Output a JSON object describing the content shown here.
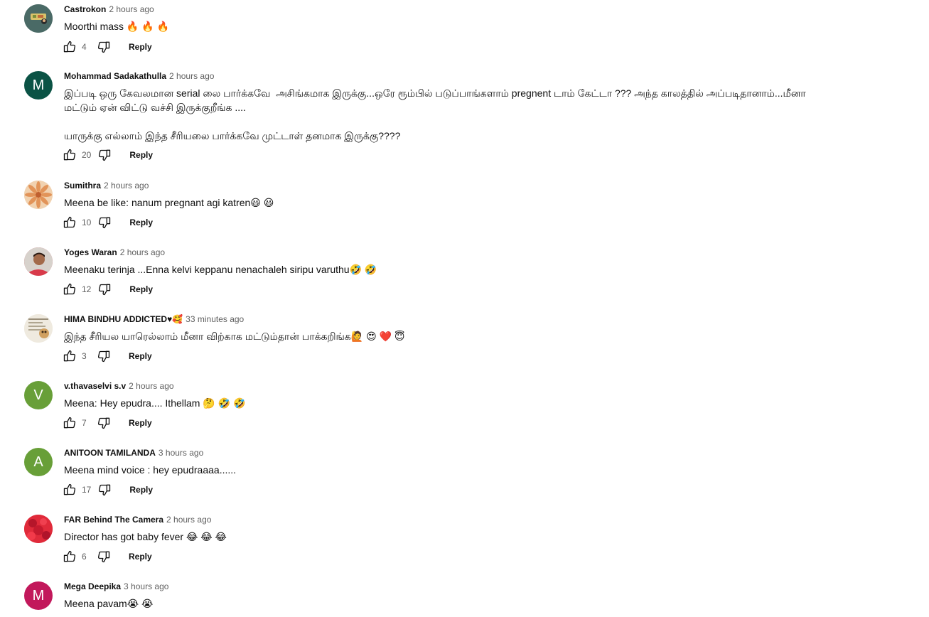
{
  "comments": [
    {
      "author": "Castrokon",
      "time": "2 hours ago",
      "text": "Moorthi mass 🔥 🔥 🔥",
      "likes": "4",
      "reply_label": "Reply",
      "avatar": {
        "type": "image-icon",
        "name": "cartoon-avatar-icon",
        "bg": "#4a6a66"
      }
    },
    {
      "author": "Mohammad Sadakathulla",
      "time": "2 hours ago",
      "text": "இப்படி ஒரு கேவலமான serial லை பார்க்கவே  அசிங்கமாக இருக்கு...ஒரே ரூம்பில் படுப்பாங்களாம் pregnent டாம் கேட்டா ??? அந்த காலத்தில் அப்படிதானாம்...மீனா மட்டும் ஏன் விட்டு வச்சி இருக்குறீங்க ....\n\nயாருக்கு எல்லாம் இந்த சீரியலை பார்க்கவே முட்டாள் தனமாக இருக்கு????",
      "likes": "20",
      "reply_label": "Reply",
      "avatar": {
        "type": "letter",
        "letter": "M",
        "bg": "#0b5345"
      }
    },
    {
      "author": "Sumithra",
      "time": "2 hours ago",
      "text": "Meena be like: nanum pregnant agi katren😃 😃",
      "likes": "10",
      "reply_label": "Reply",
      "avatar": {
        "type": "image-icon",
        "name": "flower-avatar-icon",
        "bg": "#e8b98a"
      }
    },
    {
      "author": "Yoges Waran",
      "time": "2 hours ago",
      "text": "Meenaku terinja ...Enna kelvi keppanu nenachaleh siripu varuthu🤣 🤣",
      "likes": "12",
      "reply_label": "Reply",
      "avatar": {
        "type": "image-icon",
        "name": "person-photo-avatar-icon",
        "bg": "#c94a55"
      }
    },
    {
      "author": "HIMA BINDHU ADDICTED♥🥰",
      "time": "33 minutes ago",
      "text": "இந்த சீரியல யாரெல்லாம் மீனா விற்காக மட்டும்தான் பாக்கறிங்க🙋 😍 ❤️ 😇",
      "likes": "3",
      "reply_label": "Reply",
      "avatar": {
        "type": "image-icon",
        "name": "poster-avatar-icon",
        "bg": "#ece6d8"
      }
    },
    {
      "author": "v.thavaselvi s.v",
      "time": "2 hours ago",
      "text": "Meena: Hey epudra.... Ithellam 🤔 🤣 🤣",
      "likes": "7",
      "reply_label": "Reply",
      "avatar": {
        "type": "letter",
        "letter": "V",
        "bg": "#689f38"
      }
    },
    {
      "author": "ANITOON TAMILANDA",
      "time": "3 hours ago",
      "text": "Meena mind voice : hey epudraaaa......",
      "likes": "17",
      "reply_label": "Reply",
      "avatar": {
        "type": "letter",
        "letter": "A",
        "bg": "#689f38"
      }
    },
    {
      "author": "FAR Behind The Camera",
      "time": "2 hours ago",
      "text": "Director has got baby fever 😂 😂 😂",
      "likes": "6",
      "reply_label": "Reply",
      "avatar": {
        "type": "image-icon",
        "name": "red-flower-avatar-icon",
        "bg": "#d81b30"
      }
    },
    {
      "author": "Mega Deepika",
      "time": "3 hours ago",
      "text": "Meena pavam😭 😭",
      "likes": "",
      "reply_label": "",
      "avatar": {
        "type": "letter",
        "letter": "M",
        "bg": "#c2185b"
      }
    }
  ],
  "icons": {
    "like": "thumbs-up-icon",
    "dislike": "thumbs-down-icon"
  }
}
